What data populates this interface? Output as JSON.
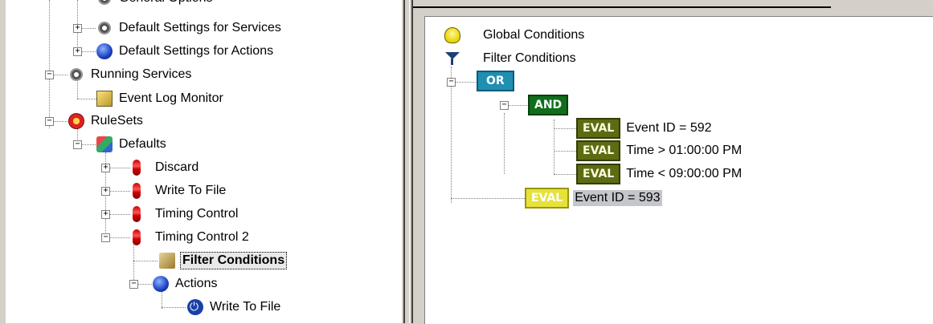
{
  "left_tree": {
    "items": [
      {
        "label": "General Options",
        "icon": "gear-icon"
      },
      {
        "label": "Default Settings for Services",
        "icon": "gear-icon"
      },
      {
        "label": "Default Settings for Actions",
        "icon": "globe-icon"
      },
      {
        "label": "Running Services",
        "icon": "gear-icon"
      },
      {
        "label": "Event Log Monitor",
        "icon": "event-log-icon"
      },
      {
        "label": "RuleSets",
        "icon": "ruleset-icon"
      },
      {
        "label": "Defaults",
        "icon": "defaults-icon"
      },
      {
        "label": "Discard",
        "icon": "rule-icon"
      },
      {
        "label": "Write To File",
        "icon": "rule-icon"
      },
      {
        "label": "Timing Control",
        "icon": "rule-icon"
      },
      {
        "label": "Timing Control 2",
        "icon": "rule-icon"
      },
      {
        "label": "Filter Conditions",
        "icon": "filter-conditions-icon",
        "selected": true
      },
      {
        "label": "Actions",
        "icon": "globe-icon"
      },
      {
        "label": "Write To File",
        "icon": "power-icon"
      }
    ]
  },
  "right_tree": {
    "global_conditions": "Global Conditions",
    "filter_conditions": "Filter Conditions",
    "or_label": "OR",
    "and_label": "AND",
    "eval_label": "EVAL",
    "conditions": [
      "Event ID = 592",
      "Time > 01:00:00 PM",
      "Time < 09:00:00 PM",
      "Event ID = 593"
    ]
  },
  "colors": {
    "or": "#1f8fb4",
    "and": "#0f6e1b",
    "eval": "#5d6c12",
    "eval_selected": "#e6e23a",
    "selection": "#c4c6cc"
  }
}
